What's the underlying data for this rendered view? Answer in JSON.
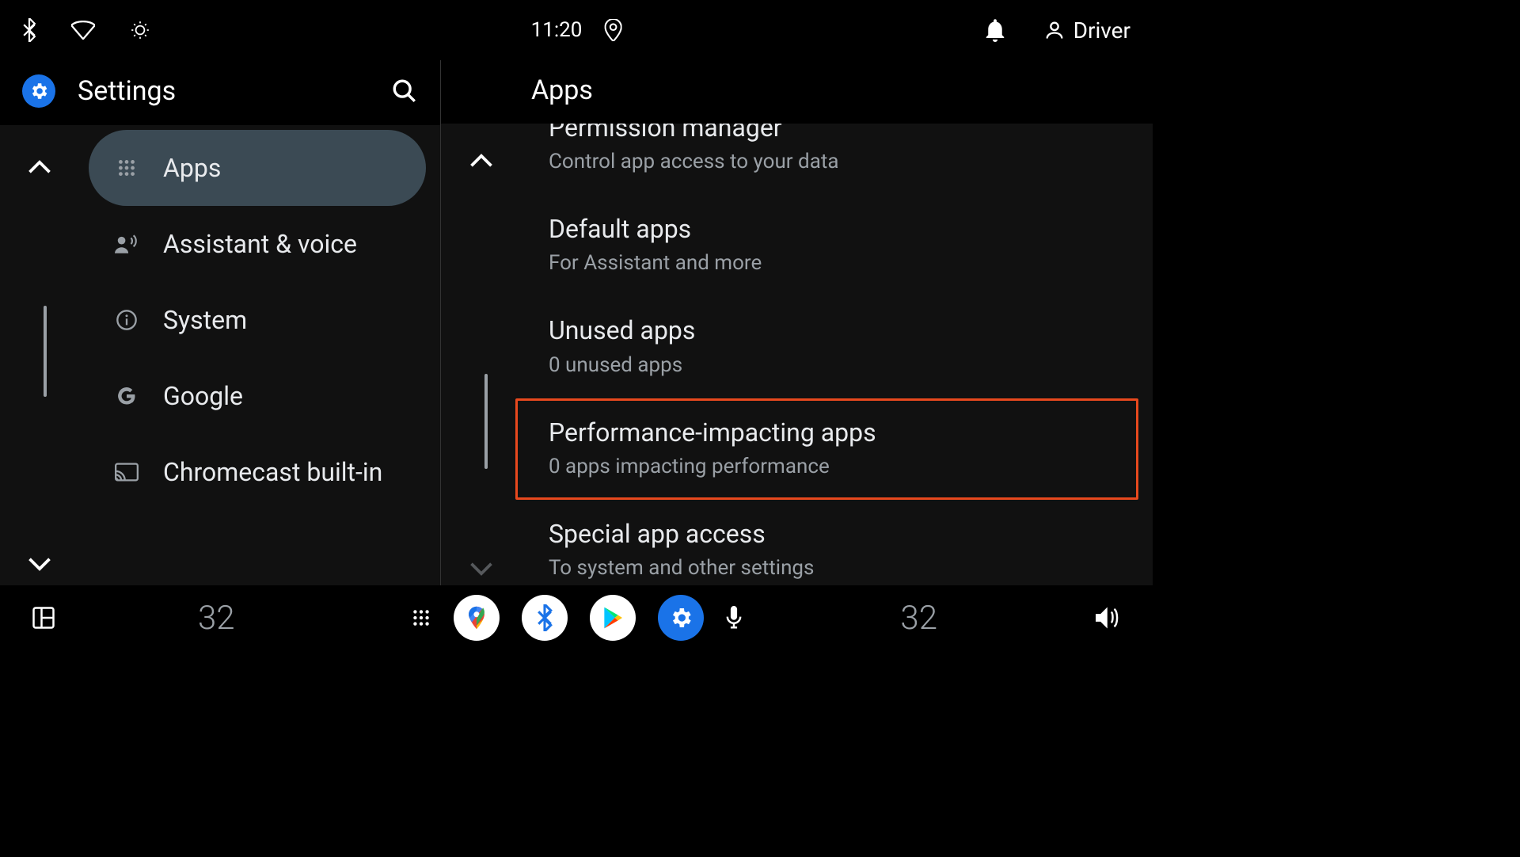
{
  "status": {
    "time": "11:20",
    "user_label": "Driver"
  },
  "settings": {
    "title": "Settings"
  },
  "sidebar": {
    "items": [
      {
        "label": "Apps"
      },
      {
        "label": "Assistant & voice"
      },
      {
        "label": "System"
      },
      {
        "label": "Google"
      },
      {
        "label": "Chromecast built-in"
      }
    ]
  },
  "detail": {
    "header": "Apps",
    "items": [
      {
        "title": "Permission manager",
        "sub": "Control app access to your data"
      },
      {
        "title": "Default apps",
        "sub": "For Assistant and more"
      },
      {
        "title": "Unused apps",
        "sub": "0 unused apps"
      },
      {
        "title": "Performance-impacting apps",
        "sub": "0 apps impacting performance"
      },
      {
        "title": "Special app access",
        "sub": "To system and other settings"
      }
    ]
  },
  "dock": {
    "temp_left": "32",
    "temp_right": "32"
  }
}
